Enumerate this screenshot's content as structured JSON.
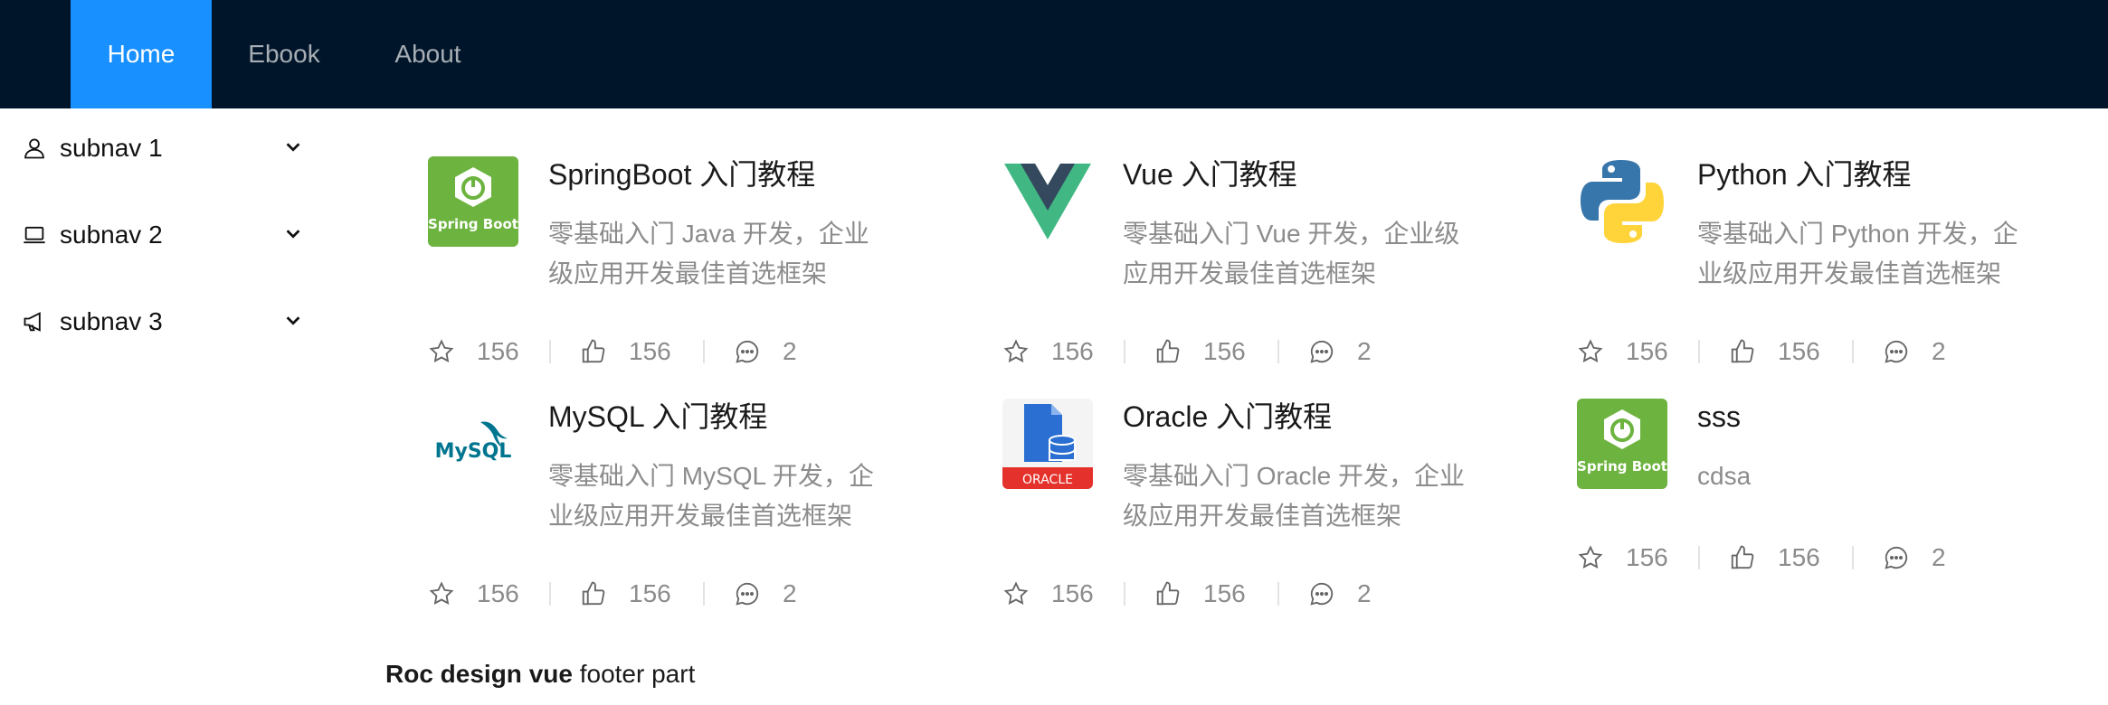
{
  "nav": {
    "items": [
      {
        "label": "Home",
        "active": true
      },
      {
        "label": "Ebook",
        "active": false
      },
      {
        "label": "About",
        "active": false
      }
    ],
    "active_color": "#1890ff",
    "bar_color": "#001529"
  },
  "sider": {
    "items": [
      {
        "label": "subnav 1",
        "icon": "user-icon"
      },
      {
        "label": "subnav 2",
        "icon": "laptop-icon"
      },
      {
        "label": "subnav 3",
        "icon": "notification-icon"
      }
    ]
  },
  "ebooks": [
    {
      "title": "SpringBoot 入门教程",
      "desc": "零基础入门 Java 开发，企业级应用开发最佳首选框架",
      "logo": "springboot-logo",
      "logo_text": "Spring Boot",
      "stars": "156",
      "likes": "156",
      "comments": "2"
    },
    {
      "title": "Vue 入门教程",
      "desc": "零基础入门 Vue 开发，企业级应用开发最佳首选框架",
      "logo": "vue-logo",
      "logo_text": "",
      "stars": "156",
      "likes": "156",
      "comments": "2"
    },
    {
      "title": "Python 入门教程",
      "desc": "零基础入门 Python 开发，企业级应用开发最佳首选框架",
      "logo": "python-logo",
      "logo_text": "",
      "stars": "156",
      "likes": "156",
      "comments": "2"
    },
    {
      "title": "MySQL 入门教程",
      "desc": "零基础入门 MySQL 开发，企业级应用开发最佳首选框架",
      "logo": "mysql-logo",
      "logo_text": "MySQL",
      "stars": "156",
      "likes": "156",
      "comments": "2"
    },
    {
      "title": "Oracle 入门教程",
      "desc": "零基础入门 Oracle 开发，企业级应用开发最佳首选框架",
      "logo": "oracle-logo",
      "logo_text": "ORACLE",
      "stars": "156",
      "likes": "156",
      "comments": "2"
    },
    {
      "title": "sss",
      "desc": "cdsa",
      "logo": "springboot-logo",
      "logo_text": "Spring Boot",
      "stars": "156",
      "likes": "156",
      "comments": "2"
    }
  ],
  "footer": {
    "bold": "Roc design vue",
    "text": " footer part"
  }
}
